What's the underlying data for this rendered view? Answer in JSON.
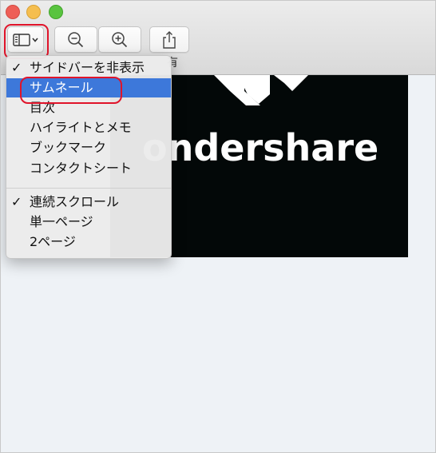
{
  "window": {
    "controls": [
      "close",
      "minimize",
      "zoom"
    ]
  },
  "toolbar": {
    "sidebar_button_icon": "sidebar-icon",
    "zoom_out_icon": "zoom-out-icon",
    "zoom_in_icon": "zoom-in-icon",
    "share_icon": "share-icon",
    "share_label_partial": "有"
  },
  "document": {
    "logo_text": "ondershare"
  },
  "menu": {
    "items": [
      {
        "label": "サイドバーを非表示",
        "checked": "✓"
      },
      {
        "label": "サムネール",
        "checked": "",
        "selected": true
      },
      {
        "label": "目次",
        "checked": ""
      },
      {
        "label": "ハイライトとメモ",
        "checked": ""
      },
      {
        "label": "ブックマーク",
        "checked": ""
      },
      {
        "label": "コンタクトシート",
        "checked": ""
      },
      {
        "label": "連続スクロール",
        "checked": "✓"
      },
      {
        "label": "単一ページ",
        "checked": ""
      },
      {
        "label": "2ページ",
        "checked": ""
      }
    ]
  },
  "colors": {
    "highlight": "#3d78da",
    "annotation_ring": "#e0142a"
  }
}
